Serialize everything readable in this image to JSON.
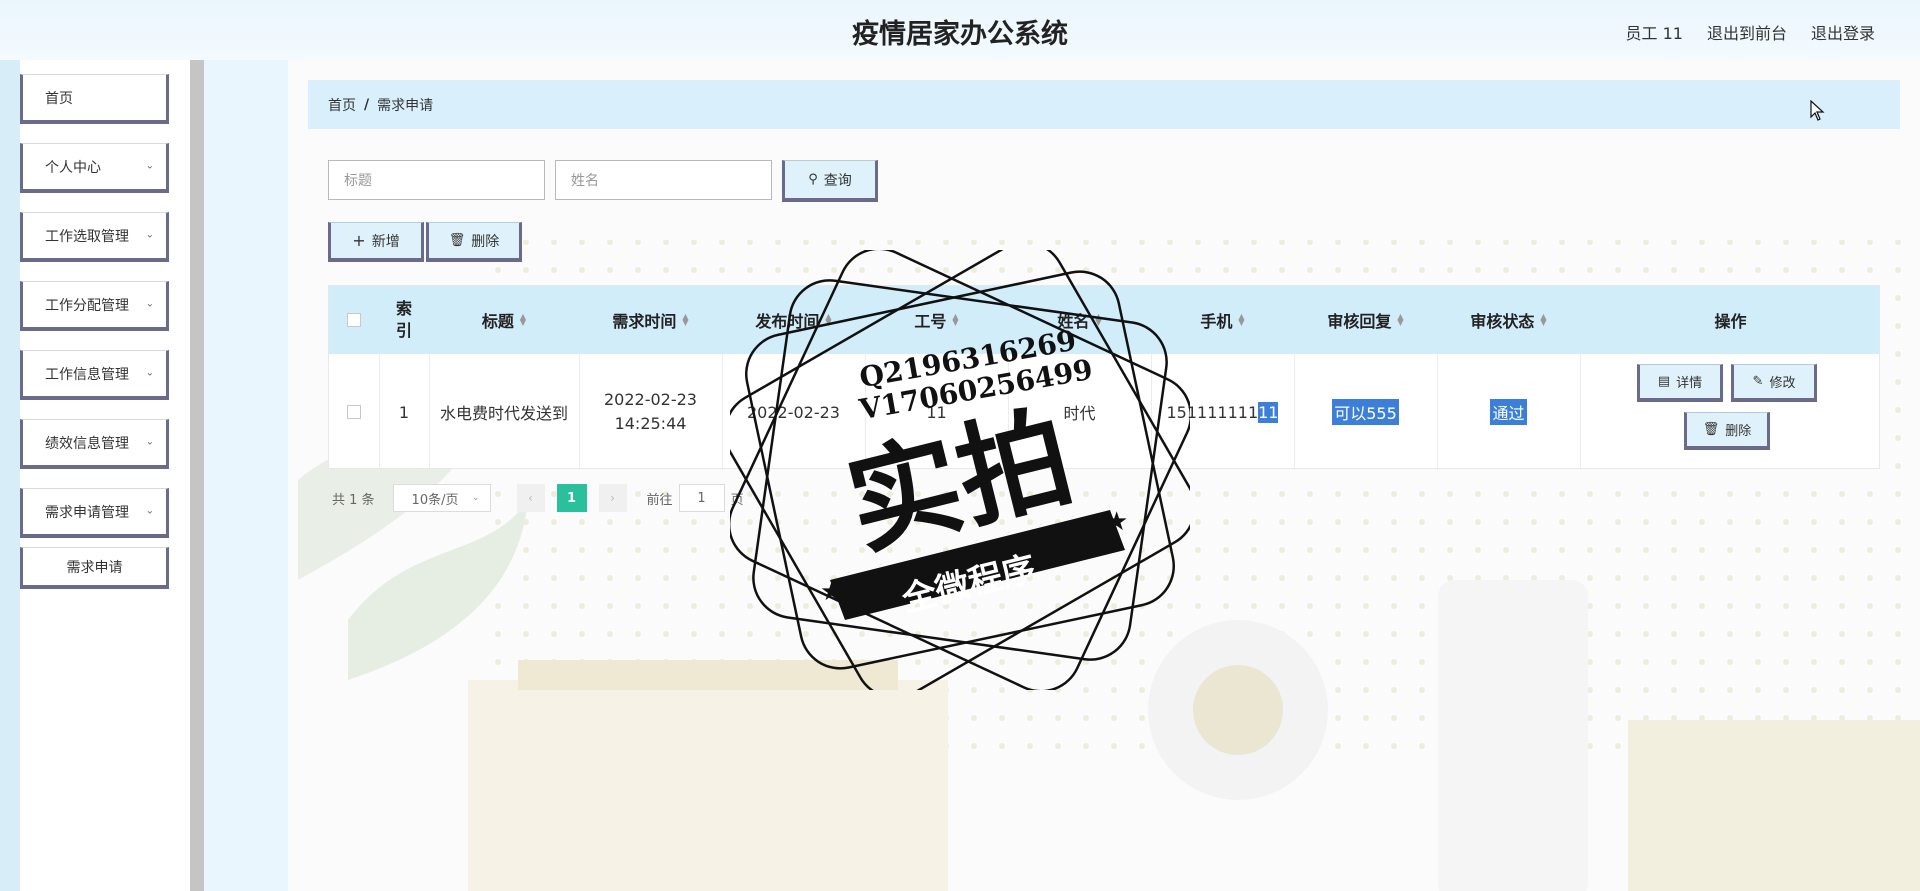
{
  "header": {
    "title": "疫情居家办公系统",
    "user": "员工 11",
    "back_to_front": "退出到前台",
    "logout": "退出登录"
  },
  "sidebar": {
    "items": [
      {
        "label": "首页",
        "has_arrow": false
      },
      {
        "label": "个人中心",
        "has_arrow": true
      },
      {
        "label": "工作选取管理",
        "has_arrow": true
      },
      {
        "label": "工作分配管理",
        "has_arrow": true
      },
      {
        "label": "工作信息管理",
        "has_arrow": true
      },
      {
        "label": "绩效信息管理",
        "has_arrow": true
      },
      {
        "label": "需求申请管理",
        "has_arrow": true
      }
    ],
    "sub_item": "需求申请"
  },
  "breadcrumb": {
    "home": "首页",
    "separator": "/",
    "current": "需求申请"
  },
  "search": {
    "title_placeholder": "标题",
    "name_placeholder": "姓名",
    "query_label": "查询"
  },
  "toolbar": {
    "add_label": "新增",
    "delete_label": "删除"
  },
  "table": {
    "headers": {
      "index": "索引",
      "title": "标题",
      "demand_time": "需求时间",
      "publish_time": "发布时间",
      "job_no": "工号",
      "name": "姓名",
      "phone": "手机",
      "review_reply": "审核回复",
      "review_status": "审核状态",
      "actions": "操作"
    },
    "rows": [
      {
        "index": "1",
        "title": "水电费时代发送到",
        "demand_time": "2022-02-23 14:25:44",
        "publish_time": "2022-02-23",
        "job_no": "11",
        "name": "时代",
        "phone_prefix": "151111111",
        "phone_selected": "11",
        "review_reply": "可以555",
        "review_status": "通过"
      }
    ],
    "action_labels": {
      "detail": "详情",
      "edit": "修改",
      "delete": "删除"
    }
  },
  "pagination": {
    "total": "共 1 条",
    "page_size": "10条/页",
    "current_page": "1",
    "goto_prefix": "前往",
    "goto_value": "1",
    "goto_suffix": "页"
  },
  "stamp": {
    "qq": "Q2196316269",
    "vx": "V17060256499",
    "big_text": "实拍",
    "banner": "全微程序"
  },
  "colors": {
    "header_bg": "#eaf6fd",
    "table_head_bg": "#d2edfa",
    "accent_green": "#2ac09b",
    "selection_blue": "#3b7fd9",
    "menu_border": "#6a6a8a"
  }
}
